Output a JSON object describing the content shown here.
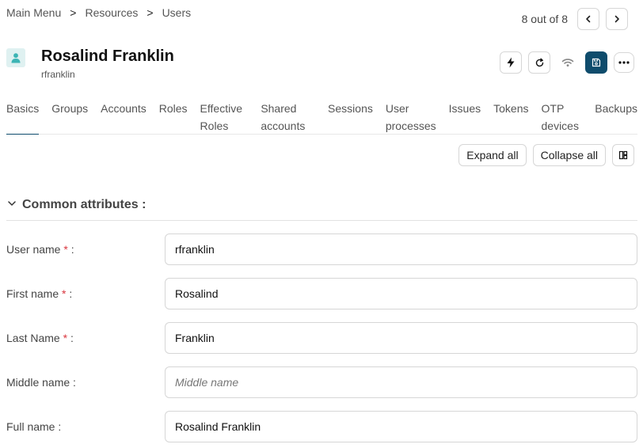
{
  "breadcrumb": {
    "items": [
      "Main Menu",
      "Resources",
      "Users"
    ],
    "separator": ">"
  },
  "pager": {
    "count_text": "8 out of 8"
  },
  "header": {
    "title": "Rosalind Franklin",
    "subtitle": "rfranklin"
  },
  "icons": {
    "avatar": "user-icon",
    "prev": "chevron-left-icon",
    "next": "chevron-right-icon",
    "action": "lightning-icon",
    "refresh": "refresh-icon",
    "wifi": "wifi-icon",
    "save": "save-icon",
    "more": "more-horizontal-icon",
    "layout": "columns-icon",
    "section": "chevron-down-icon"
  },
  "colors": {
    "accent": "#0f4c6c",
    "avatar_bg": "#dff1f1",
    "avatar_fg": "#3cb4b4",
    "required": "#d9363e"
  },
  "tabs": [
    {
      "label": "Basics",
      "active": true
    },
    {
      "label": "Groups"
    },
    {
      "label": "Accounts"
    },
    {
      "label": "Roles"
    },
    {
      "label": "Effective Roles"
    },
    {
      "label": "Shared accounts"
    },
    {
      "label": "Sessions"
    },
    {
      "label": "User processes"
    },
    {
      "label": "Issues"
    },
    {
      "label": "Tokens"
    },
    {
      "label": "OTP devices"
    },
    {
      "label": "Backups"
    }
  ],
  "toolbar": {
    "expand_label": "Expand all",
    "collapse_label": "Collapse all"
  },
  "section": {
    "title": "Common attributes :"
  },
  "fields": {
    "username": {
      "label": "User name",
      "required": "*",
      "colon": ":",
      "value": "rfranklin"
    },
    "first_name": {
      "label": "First name",
      "required": "*",
      "colon": ":",
      "value": "Rosalind"
    },
    "last_name": {
      "label": "Last Name",
      "required": "*",
      "colon": ":",
      "value": "Franklin"
    },
    "middle_name": {
      "label": "Middle name",
      "colon": ":",
      "value": "",
      "placeholder": "Middle name"
    },
    "full_name": {
      "label": "Full name",
      "colon": ":",
      "value": "Rosalind Franklin"
    }
  }
}
